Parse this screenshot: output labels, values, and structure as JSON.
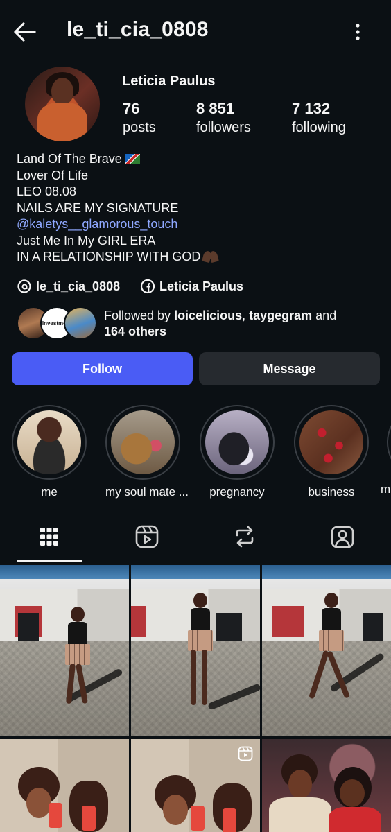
{
  "header": {
    "username": "le_ti_cia_0808",
    "back_icon": "arrow-left-icon",
    "more_icon": "more-vertical-icon"
  },
  "profile": {
    "full_name": "Leticia Paulus",
    "stats": [
      {
        "value": "76",
        "label": "posts"
      },
      {
        "value": "8 851",
        "label": "followers"
      },
      {
        "value": "7 132",
        "label": "following"
      }
    ]
  },
  "bio": {
    "lines": [
      "Land Of The Brave",
      "Lover Of Life",
      "LEO 08.08",
      "NAILS ARE MY SIGNATURE",
      "@kaletys__glamorous_touch",
      "Just Me In My GIRL ERA",
      "IN A RELATIONSHIP WITH GOD"
    ]
  },
  "social": {
    "threads": "le_ti_cia_0808",
    "facebook": "Leticia Paulus"
  },
  "followed_by": {
    "prefix": "Followed by ",
    "user1": "loicelicious",
    "separator": ", ",
    "user2": "taygegram",
    "and": " and",
    "others": "164 others",
    "avatar2_text": "Investment"
  },
  "buttons": {
    "follow": "Follow",
    "message": "Message"
  },
  "highlights": [
    {
      "label": "me"
    },
    {
      "label": "my soul mate ..."
    },
    {
      "label": "pregnancy"
    },
    {
      "label": "business"
    },
    {
      "label": "m"
    }
  ],
  "tabs": [
    {
      "name": "grid-icon",
      "active": true
    },
    {
      "name": "reels-icon",
      "active": false
    },
    {
      "name": "repost-icon",
      "active": false
    },
    {
      "name": "tagged-icon",
      "active": false
    }
  ],
  "colors": {
    "background": "#0b1014",
    "follow_button": "#4a5cf5",
    "message_button": "#262a2f",
    "link": "#8fa8ff"
  }
}
